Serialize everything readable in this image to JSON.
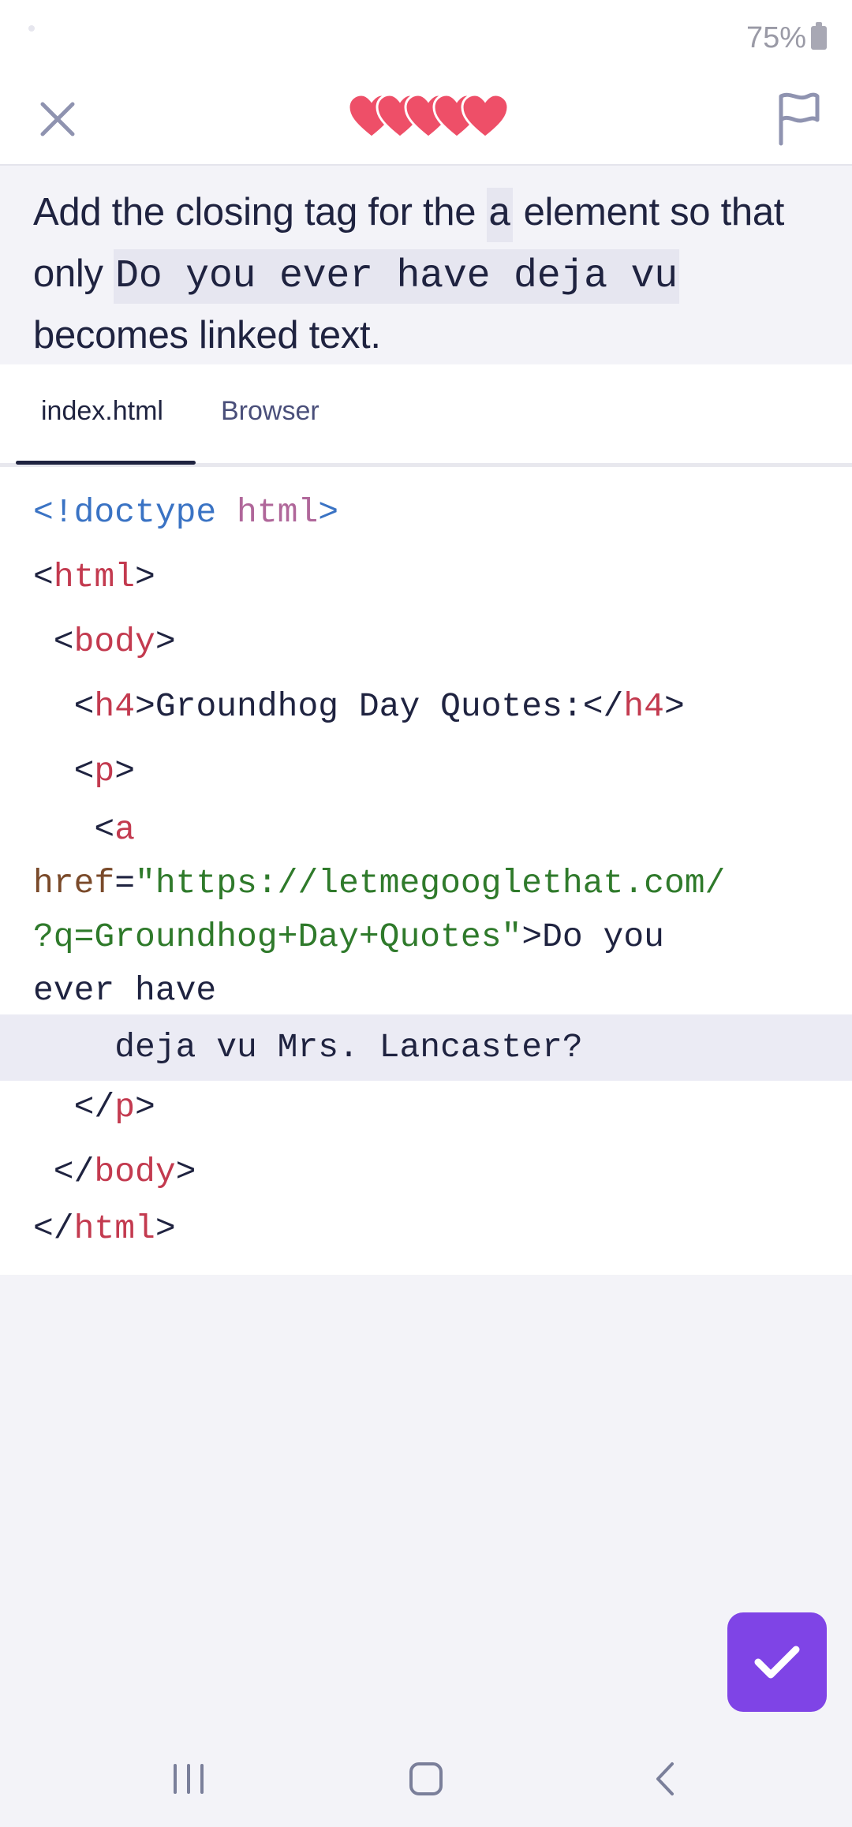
{
  "status": {
    "battery": "75%"
  },
  "topbar": {
    "hearts_count": 5,
    "heart_color": "#ee4f68",
    "close_icon": "close-icon",
    "flag_icon": "flag-icon"
  },
  "prompt": {
    "part1": "Add the closing tag for the ",
    "code1": "a",
    "part2": " element so that only ",
    "code2": "Do you ever have deja vu",
    "part3": " becomes linked text."
  },
  "tabs": [
    {
      "label": "index.html",
      "active": true
    },
    {
      "label": "Browser",
      "active": false
    }
  ],
  "code": {
    "l1_open": "<!doctype",
    "l1_html": " html",
    "l1_close": ">",
    "l2_lt": "<",
    "l2_tag": "html",
    "l2_gt": ">",
    "l3_lt": " <",
    "l3_tag": "body",
    "l3_gt": ">",
    "l4_lt": "  <",
    "l4_tag": "h4",
    "l4_text": ">Groundhog Day Quotes:</",
    "l4_tag2": "h4",
    "l4_gt": ">",
    "l5_lt": "  <",
    "l5_tag": "p",
    "l5_gt": ">",
    "l6_lt": "   <",
    "l6_tag": "a",
    "l7_attr": "href",
    "l7_eq": "=",
    "l7_val": "\"https://letmegooglethat.com/",
    "l8_val": "?q=Groundhog+Day+Quotes\"",
    "l8_text": ">Do you",
    "l9_text": "ever have",
    "l10_text": "    deja vu Mrs. Lancaster?",
    "l11_lt": "  </",
    "l11_tag": "p",
    "l11_gt": ">",
    "l12_lt": " </",
    "l12_tag": "body",
    "l12_gt": ">",
    "l13_lt": "</",
    "l13_tag": "html",
    "l13_gt": ">"
  },
  "check_button": {
    "icon": "check-icon",
    "color": "#7f44e6"
  },
  "navbar": {
    "recent_icon": "recent-apps-icon",
    "home_icon": "home-icon",
    "back_icon": "back-icon"
  }
}
